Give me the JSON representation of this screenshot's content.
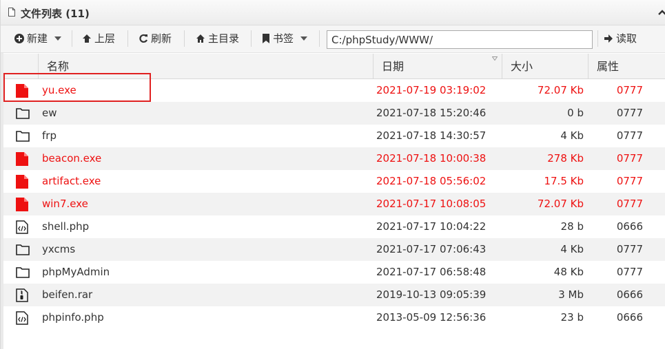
{
  "titlebar": {
    "title": "文件列表 (11)"
  },
  "toolbar": {
    "new_label": "新建",
    "up_label": "上层",
    "refresh_label": "刷新",
    "home_label": "主目录",
    "bookmark_label": "书签",
    "read_label": "读取"
  },
  "path": {
    "value": "C:/phpStudy/WWW/"
  },
  "columns": {
    "name": "名称",
    "date": "日期",
    "size": "大小",
    "attr": "属性"
  },
  "colors": {
    "danger": "#ee1111",
    "highlight": "#e02020"
  },
  "files": [
    {
      "name": "yu.exe",
      "date": "2021-07-19 03:19:02",
      "size": "72.07 Kb",
      "attr": "0777",
      "icon": "file-red-icon",
      "red": true
    },
    {
      "name": "ew",
      "date": "2021-07-18 15:20:46",
      "size": "0 b",
      "attr": "0777",
      "icon": "folder-icon",
      "red": false
    },
    {
      "name": "frp",
      "date": "2021-07-18 14:30:57",
      "size": "4 Kb",
      "attr": "0777",
      "icon": "folder-icon",
      "red": false
    },
    {
      "name": "beacon.exe",
      "date": "2021-07-18 10:00:38",
      "size": "278 Kb",
      "attr": "0777",
      "icon": "file-red-icon",
      "red": true
    },
    {
      "name": "artifact.exe",
      "date": "2021-07-18 05:56:02",
      "size": "17.5 Kb",
      "attr": "0777",
      "icon": "file-red-icon",
      "red": true
    },
    {
      "name": "win7.exe",
      "date": "2021-07-17 10:08:05",
      "size": "72.07 Kb",
      "attr": "0777",
      "icon": "file-red-icon",
      "red": true
    },
    {
      "name": "shell.php",
      "date": "2021-07-17 10:04:22",
      "size": "28 b",
      "attr": "0666",
      "icon": "code-file-icon",
      "red": false
    },
    {
      "name": "yxcms",
      "date": "2021-07-17 07:06:43",
      "size": "4 Kb",
      "attr": "0777",
      "icon": "folder-icon",
      "red": false
    },
    {
      "name": "phpMyAdmin",
      "date": "2021-07-17 06:58:48",
      "size": "48 Kb",
      "attr": "0777",
      "icon": "folder-icon",
      "red": false
    },
    {
      "name": "beifen.rar",
      "date": "2019-10-13 09:05:39",
      "size": "3 Mb",
      "attr": "0666",
      "icon": "archive-file-icon",
      "red": false
    },
    {
      "name": "phpinfo.php",
      "date": "2013-05-09 12:56:36",
      "size": "23 b",
      "attr": "0666",
      "icon": "code-file-icon",
      "red": false
    }
  ]
}
